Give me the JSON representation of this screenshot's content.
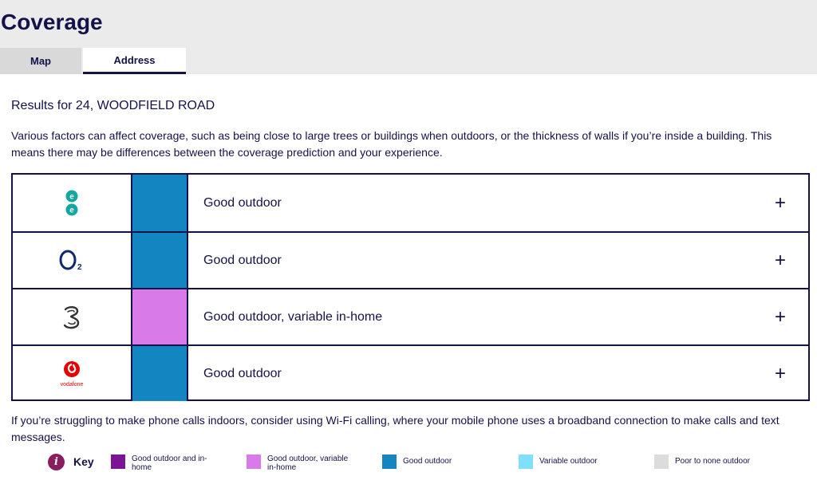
{
  "page": {
    "title": "Coverage"
  },
  "tabs": [
    {
      "label": "Map",
      "active": false
    },
    {
      "label": "Address",
      "active": true
    }
  ],
  "results_title": "Results for 24, WOODFIELD ROAD",
  "intro": "Various factors can affect coverage, such as being close to large trees or buildings when outdoors, or the thickness of walls if you’re inside a building. This means there may be differences between the coverage prediction and your experience.",
  "operators": [
    {
      "logo": "ee-logo",
      "coverage": "Good outdoor",
      "color": "#1385c0"
    },
    {
      "logo": "o2-logo",
      "coverage": "Good outdoor",
      "color": "#1385c0"
    },
    {
      "logo": "three-logo",
      "coverage": "Good outdoor, variable in-home",
      "color": "#d97ae9"
    },
    {
      "logo": "vodafone-logo",
      "logo_text": "vodafone",
      "coverage": "Good outdoor",
      "color": "#1385c0"
    }
  ],
  "expand_label": "+",
  "footer_text": "If you’re struggling to make phone calls indoors, consider using Wi-Fi calling, where your mobile phone uses a broadband connection to make calls and text messages.",
  "key": {
    "title": "Key",
    "info_icon": "i",
    "items": [
      {
        "label": "Good outdoor and in-home",
        "color": "#7c1594"
      },
      {
        "label": "Good outdoor, variable in-home",
        "color": "#d97ae9"
      },
      {
        "label": "Good outdoor",
        "color": "#1385c0"
      },
      {
        "label": "Variable outdoor",
        "color": "#7fe0fb"
      },
      {
        "label": "Poor to none outdoor",
        "color": "#dcdcdc"
      }
    ]
  }
}
